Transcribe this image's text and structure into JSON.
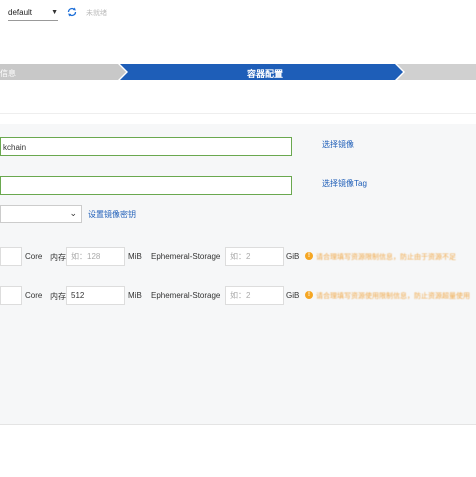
{
  "header": {
    "namespace_select": "default",
    "status_text": "未就绪"
  },
  "steps": {
    "previous": "信息",
    "current": "容器配置"
  },
  "image": {
    "image_value": "kchain",
    "image_link": "选择镜像",
    "tag_value": "",
    "tag_link": "选择镜像Tag",
    "secret_link": "设置镜像密钥"
  },
  "resources": {
    "row1": {
      "cpu_unit": "Core",
      "memory_label": "内存",
      "memory_placeholder": "如：128",
      "memory_unit": "MiB",
      "ephemeral_label": "Ephemeral-Storage",
      "ephemeral_placeholder": "如：2",
      "ephemeral_unit": "GiB",
      "warning": "请合理填写资源限制信息，防止由于资源不足"
    },
    "row2": {
      "cpu_unit": "Core",
      "memory_label": "内存",
      "memory_value": "512",
      "memory_unit": "MiB",
      "ephemeral_label": "Ephemeral-Storage",
      "ephemeral_placeholder": "如：2",
      "ephemeral_unit": "GiB",
      "warning": "请合理填写资源使用限制信息，防止资源超量使用"
    }
  },
  "colors": {
    "step_active": "#1e5eb8",
    "step_inactive": "#c8c8c8",
    "input_border_ok": "#6aa84f",
    "link": "#1e5eb8",
    "warning": "#f5a623"
  }
}
